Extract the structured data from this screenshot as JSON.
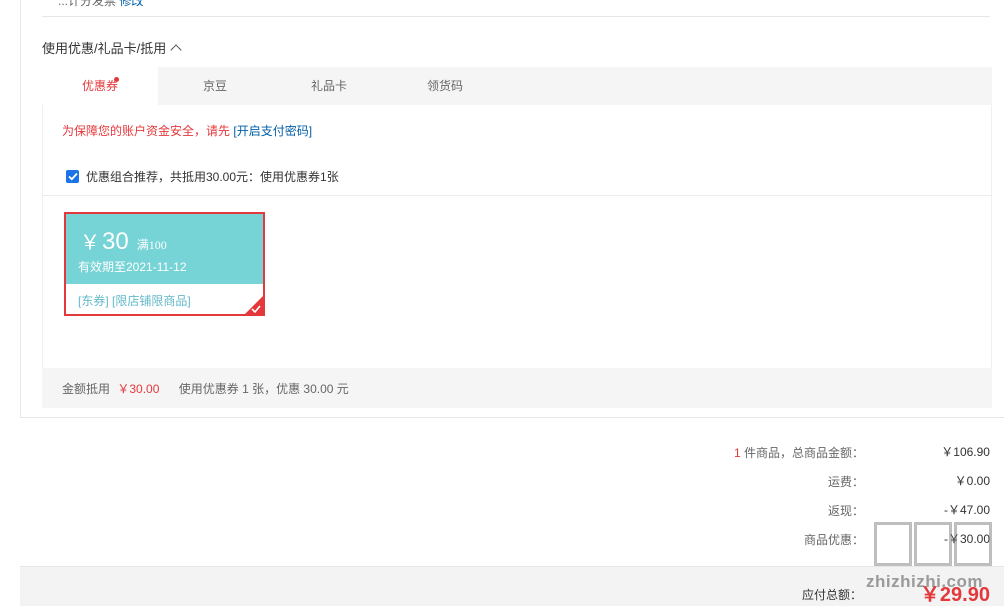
{
  "top_partial": {
    "text": "...计分发票",
    "link": "修改"
  },
  "section": {
    "title": "使用优惠/礼品卡/抵用"
  },
  "tabs": [
    {
      "label": "优惠券"
    },
    {
      "label": "京豆"
    },
    {
      "label": "礼品卡"
    },
    {
      "label": "领货码"
    }
  ],
  "security": {
    "tip": "为保障您的账户资金安全，请先",
    "link": "[开启支付密码]"
  },
  "combo": {
    "label": "优惠组合推荐，共抵用30.00元：使用优惠券1张",
    "checked": true
  },
  "coupon": {
    "currency": "￥",
    "amount": "30",
    "condition": "满100",
    "expiry": "有效期至2021-11-12",
    "tags": "[东券]  [限店铺限商品]",
    "selected": true
  },
  "summary": {
    "label": "金额抵用",
    "amount": "￥30.00",
    "detail": "使用优惠券 1 张，优惠 30.00 元"
  },
  "totals": {
    "count": "1",
    "items_label": " 件商品，总商品金额：",
    "items_value": "￥106.90",
    "shipping_label": "运费：",
    "shipping_value": "￥0.00",
    "cashback_label": "返现：",
    "cashback_value": "-￥47.00",
    "discount_label": "商品优惠：",
    "discount_value": "-￥30.00",
    "payable_label": "应付总额：",
    "payable_value": "￥29.90"
  },
  "watermark": {
    "text": "zhizhizhi.com"
  },
  "colors": {
    "accent_red": "#e4393c",
    "coupon_teal": "#76d3d6",
    "link_blue": "#005ea7"
  }
}
